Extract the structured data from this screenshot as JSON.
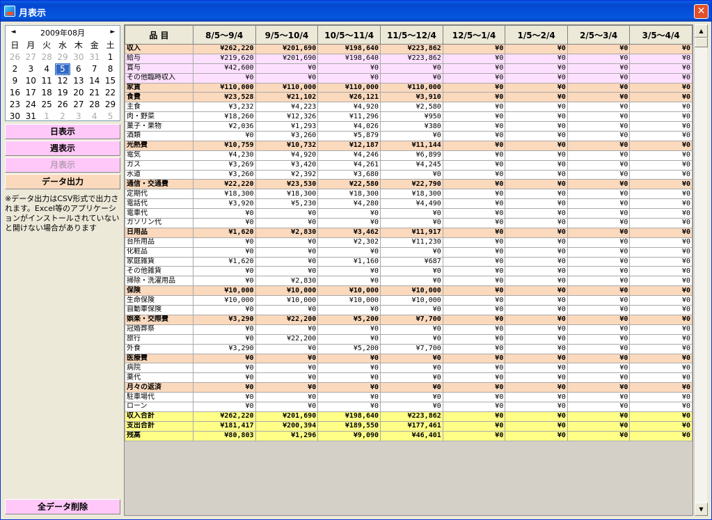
{
  "window": {
    "title": "月表示",
    "close": "✕"
  },
  "calendar": {
    "title": "2009年08月",
    "prev": "◄",
    "next": "►",
    "weekdays": [
      "日",
      "月",
      "火",
      "水",
      "木",
      "金",
      "土"
    ],
    "weeks": [
      [
        "26",
        "27",
        "28",
        "29",
        "30",
        "31",
        "1"
      ],
      [
        "2",
        "3",
        "4",
        "5",
        "6",
        "7",
        "8"
      ],
      [
        "9",
        "10",
        "11",
        "12",
        "13",
        "14",
        "15"
      ],
      [
        "16",
        "17",
        "18",
        "19",
        "20",
        "21",
        "22"
      ],
      [
        "23",
        "24",
        "25",
        "26",
        "27",
        "28",
        "29"
      ],
      [
        "30",
        "31",
        "1",
        "2",
        "3",
        "4",
        "5"
      ]
    ],
    "selected": "5"
  },
  "buttons": {
    "day": "日表示",
    "week": "週表示",
    "month": "月表示",
    "export": "データ出力",
    "delete_all": "全データ削除"
  },
  "note": "※データ出力はCSV形式で出力されます。Excel等のアプリケーションがインストールされていないと開けない場合があります",
  "table": {
    "headers": [
      "品 目",
      "8/5～9/4",
      "9/5～10/4",
      "10/5～11/4",
      "11/5～12/4",
      "12/5～1/4",
      "1/5～2/4",
      "2/5～3/4",
      "3/5～4/4"
    ],
    "rows": [
      {
        "type": "cat",
        "name": "収入",
        "values": [
          "¥262,220",
          "¥201,690",
          "¥198,640",
          "¥223,862",
          "¥0",
          "¥0",
          "¥0",
          "¥0"
        ]
      },
      {
        "type": "inc",
        "name": "給与",
        "values": [
          "¥219,620",
          "¥201,690",
          "¥198,640",
          "¥223,862",
          "¥0",
          "¥0",
          "¥0",
          "¥0"
        ]
      },
      {
        "type": "inc",
        "name": "賞与",
        "values": [
          "¥42,600",
          "¥0",
          "¥0",
          "¥0",
          "¥0",
          "¥0",
          "¥0",
          "¥0"
        ]
      },
      {
        "type": "inc",
        "name": "その他臨時収入",
        "values": [
          "¥0",
          "¥0",
          "¥0",
          "¥0",
          "¥0",
          "¥0",
          "¥0",
          "¥0"
        ]
      },
      {
        "type": "cat",
        "name": "家賃",
        "values": [
          "¥110,000",
          "¥110,000",
          "¥110,000",
          "¥110,000",
          "¥0",
          "¥0",
          "¥0",
          "¥0"
        ]
      },
      {
        "type": "cat",
        "name": "食費",
        "values": [
          "¥23,528",
          "¥21,102",
          "¥26,121",
          "¥3,910",
          "¥0",
          "¥0",
          "¥0",
          "¥0"
        ]
      },
      {
        "type": "item",
        "name": "主食",
        "values": [
          "¥3,232",
          "¥4,223",
          "¥4,920",
          "¥2,580",
          "¥0",
          "¥0",
          "¥0",
          "¥0"
        ]
      },
      {
        "type": "item",
        "name": "肉・野菜",
        "values": [
          "¥18,260",
          "¥12,326",
          "¥11,296",
          "¥950",
          "¥0",
          "¥0",
          "¥0",
          "¥0"
        ]
      },
      {
        "type": "item",
        "name": "菓子・果物",
        "values": [
          "¥2,036",
          "¥1,293",
          "¥4,026",
          "¥380",
          "¥0",
          "¥0",
          "¥0",
          "¥0"
        ]
      },
      {
        "type": "item",
        "name": "酒類",
        "values": [
          "¥0",
          "¥3,260",
          "¥5,879",
          "¥0",
          "¥0",
          "¥0",
          "¥0",
          "¥0"
        ]
      },
      {
        "type": "cat",
        "name": "光熱費",
        "values": [
          "¥10,759",
          "¥10,732",
          "¥12,187",
          "¥11,144",
          "¥0",
          "¥0",
          "¥0",
          "¥0"
        ]
      },
      {
        "type": "item",
        "name": "電気",
        "values": [
          "¥4,230",
          "¥4,920",
          "¥4,246",
          "¥6,899",
          "¥0",
          "¥0",
          "¥0",
          "¥0"
        ]
      },
      {
        "type": "item",
        "name": "ガス",
        "values": [
          "¥3,269",
          "¥3,420",
          "¥4,261",
          "¥4,245",
          "¥0",
          "¥0",
          "¥0",
          "¥0"
        ]
      },
      {
        "type": "item",
        "name": "水道",
        "values": [
          "¥3,260",
          "¥2,392",
          "¥3,680",
          "¥0",
          "¥0",
          "¥0",
          "¥0",
          "¥0"
        ]
      },
      {
        "type": "cat",
        "name": "通信・交通費",
        "values": [
          "¥22,220",
          "¥23,530",
          "¥22,580",
          "¥22,790",
          "¥0",
          "¥0",
          "¥0",
          "¥0"
        ]
      },
      {
        "type": "item",
        "name": "定期代",
        "values": [
          "¥18,300",
          "¥18,300",
          "¥18,300",
          "¥18,300",
          "¥0",
          "¥0",
          "¥0",
          "¥0"
        ]
      },
      {
        "type": "item",
        "name": "電話代",
        "values": [
          "¥3,920",
          "¥5,230",
          "¥4,280",
          "¥4,490",
          "¥0",
          "¥0",
          "¥0",
          "¥0"
        ]
      },
      {
        "type": "item",
        "name": "電車代",
        "values": [
          "¥0",
          "¥0",
          "¥0",
          "¥0",
          "¥0",
          "¥0",
          "¥0",
          "¥0"
        ]
      },
      {
        "type": "item",
        "name": "ガソリン代",
        "values": [
          "¥0",
          "¥0",
          "¥0",
          "¥0",
          "¥0",
          "¥0",
          "¥0",
          "¥0"
        ]
      },
      {
        "type": "cat",
        "name": "日用品",
        "values": [
          "¥1,620",
          "¥2,830",
          "¥3,462",
          "¥11,917",
          "¥0",
          "¥0",
          "¥0",
          "¥0"
        ]
      },
      {
        "type": "item",
        "name": "台所用品",
        "values": [
          "¥0",
          "¥0",
          "¥2,302",
          "¥11,230",
          "¥0",
          "¥0",
          "¥0",
          "¥0"
        ]
      },
      {
        "type": "item",
        "name": "化粧品",
        "values": [
          "¥0",
          "¥0",
          "¥0",
          "¥0",
          "¥0",
          "¥0",
          "¥0",
          "¥0"
        ]
      },
      {
        "type": "item",
        "name": "家庭雑貨",
        "values": [
          "¥1,620",
          "¥0",
          "¥1,160",
          "¥687",
          "¥0",
          "¥0",
          "¥0",
          "¥0"
        ]
      },
      {
        "type": "item",
        "name": "その他雑貨",
        "values": [
          "¥0",
          "¥0",
          "¥0",
          "¥0",
          "¥0",
          "¥0",
          "¥0",
          "¥0"
        ]
      },
      {
        "type": "item",
        "name": "掃除・洗濯用品",
        "values": [
          "¥0",
          "¥2,830",
          "¥0",
          "¥0",
          "¥0",
          "¥0",
          "¥0",
          "¥0"
        ]
      },
      {
        "type": "cat",
        "name": "保険",
        "values": [
          "¥10,000",
          "¥10,000",
          "¥10,000",
          "¥10,000",
          "¥0",
          "¥0",
          "¥0",
          "¥0"
        ]
      },
      {
        "type": "item",
        "name": "生命保険",
        "values": [
          "¥10,000",
          "¥10,000",
          "¥10,000",
          "¥10,000",
          "¥0",
          "¥0",
          "¥0",
          "¥0"
        ]
      },
      {
        "type": "item",
        "name": "自動車保険",
        "values": [
          "¥0",
          "¥0",
          "¥0",
          "¥0",
          "¥0",
          "¥0",
          "¥0",
          "¥0"
        ]
      },
      {
        "type": "cat",
        "name": "娯楽・交際費",
        "values": [
          "¥3,290",
          "¥22,200",
          "¥5,200",
          "¥7,700",
          "¥0",
          "¥0",
          "¥0",
          "¥0"
        ]
      },
      {
        "type": "item",
        "name": "冠婚葬祭",
        "values": [
          "¥0",
          "¥0",
          "¥0",
          "¥0",
          "¥0",
          "¥0",
          "¥0",
          "¥0"
        ]
      },
      {
        "type": "item",
        "name": "旅行",
        "values": [
          "¥0",
          "¥22,200",
          "¥0",
          "¥0",
          "¥0",
          "¥0",
          "¥0",
          "¥0"
        ]
      },
      {
        "type": "item",
        "name": "外食",
        "values": [
          "¥3,290",
          "¥0",
          "¥5,200",
          "¥7,700",
          "¥0",
          "¥0",
          "¥0",
          "¥0"
        ]
      },
      {
        "type": "cat",
        "name": "医療費",
        "values": [
          "¥0",
          "¥0",
          "¥0",
          "¥0",
          "¥0",
          "¥0",
          "¥0",
          "¥0"
        ]
      },
      {
        "type": "item",
        "name": "病院",
        "values": [
          "¥0",
          "¥0",
          "¥0",
          "¥0",
          "¥0",
          "¥0",
          "¥0",
          "¥0"
        ]
      },
      {
        "type": "item",
        "name": "薬代",
        "values": [
          "¥0",
          "¥0",
          "¥0",
          "¥0",
          "¥0",
          "¥0",
          "¥0",
          "¥0"
        ]
      },
      {
        "type": "cat",
        "name": "月々の返済",
        "values": [
          "¥0",
          "¥0",
          "¥0",
          "¥0",
          "¥0",
          "¥0",
          "¥0",
          "¥0"
        ]
      },
      {
        "type": "item",
        "name": "駐車場代",
        "values": [
          "¥0",
          "¥0",
          "¥0",
          "¥0",
          "¥0",
          "¥0",
          "¥0",
          "¥0"
        ]
      },
      {
        "type": "item",
        "name": "ローン",
        "values": [
          "¥0",
          "¥0",
          "¥0",
          "¥0",
          "¥0",
          "¥0",
          "¥0",
          "¥0"
        ]
      },
      {
        "type": "tot",
        "name": "収入合計",
        "values": [
          "¥262,220",
          "¥201,690",
          "¥198,640",
          "¥223,862",
          "¥0",
          "¥0",
          "¥0",
          "¥0"
        ]
      },
      {
        "type": "tot",
        "name": "支出合計",
        "values": [
          "¥181,417",
          "¥200,394",
          "¥189,550",
          "¥177,461",
          "¥0",
          "¥0",
          "¥0",
          "¥0"
        ]
      },
      {
        "type": "tot",
        "name": "残高",
        "values": [
          "¥80,803",
          "¥1,296",
          "¥9,090",
          "¥46,401",
          "¥0",
          "¥0",
          "¥0",
          "¥0"
        ]
      }
    ]
  },
  "scrollbar": {
    "up": "▲",
    "down": "▼"
  }
}
